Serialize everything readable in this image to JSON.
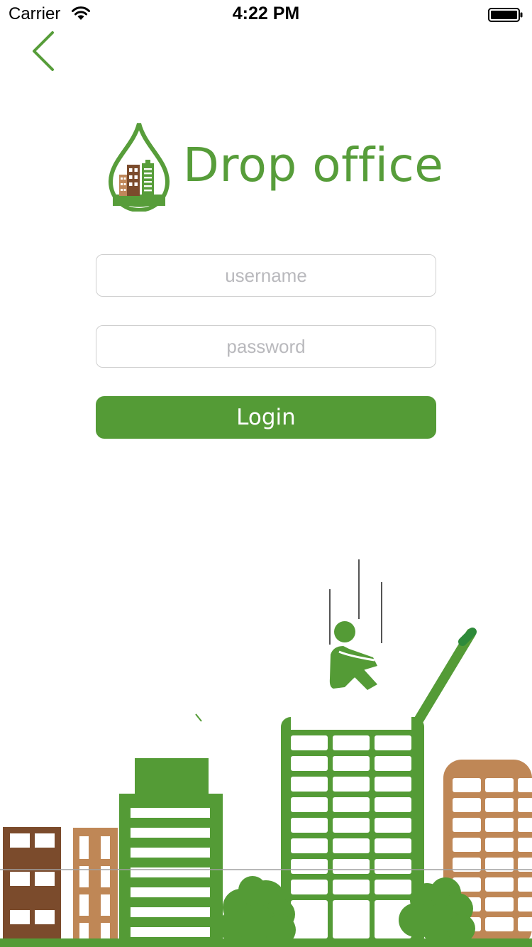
{
  "status_bar": {
    "carrier": "Carrier",
    "time": "4:22 PM"
  },
  "brand": {
    "name": "Drop office"
  },
  "form": {
    "username_placeholder": "username",
    "password_placeholder": "password",
    "login_label": "Login"
  },
  "icons": {
    "back": "chevron-left-icon",
    "wifi": "wifi-icon",
    "battery": "battery-icon",
    "logo": "drop-buildings-logo"
  },
  "colors": {
    "brand_green": "#549b36",
    "light_brown": "#bf8756",
    "dark_brown": "#7b4b2c"
  }
}
